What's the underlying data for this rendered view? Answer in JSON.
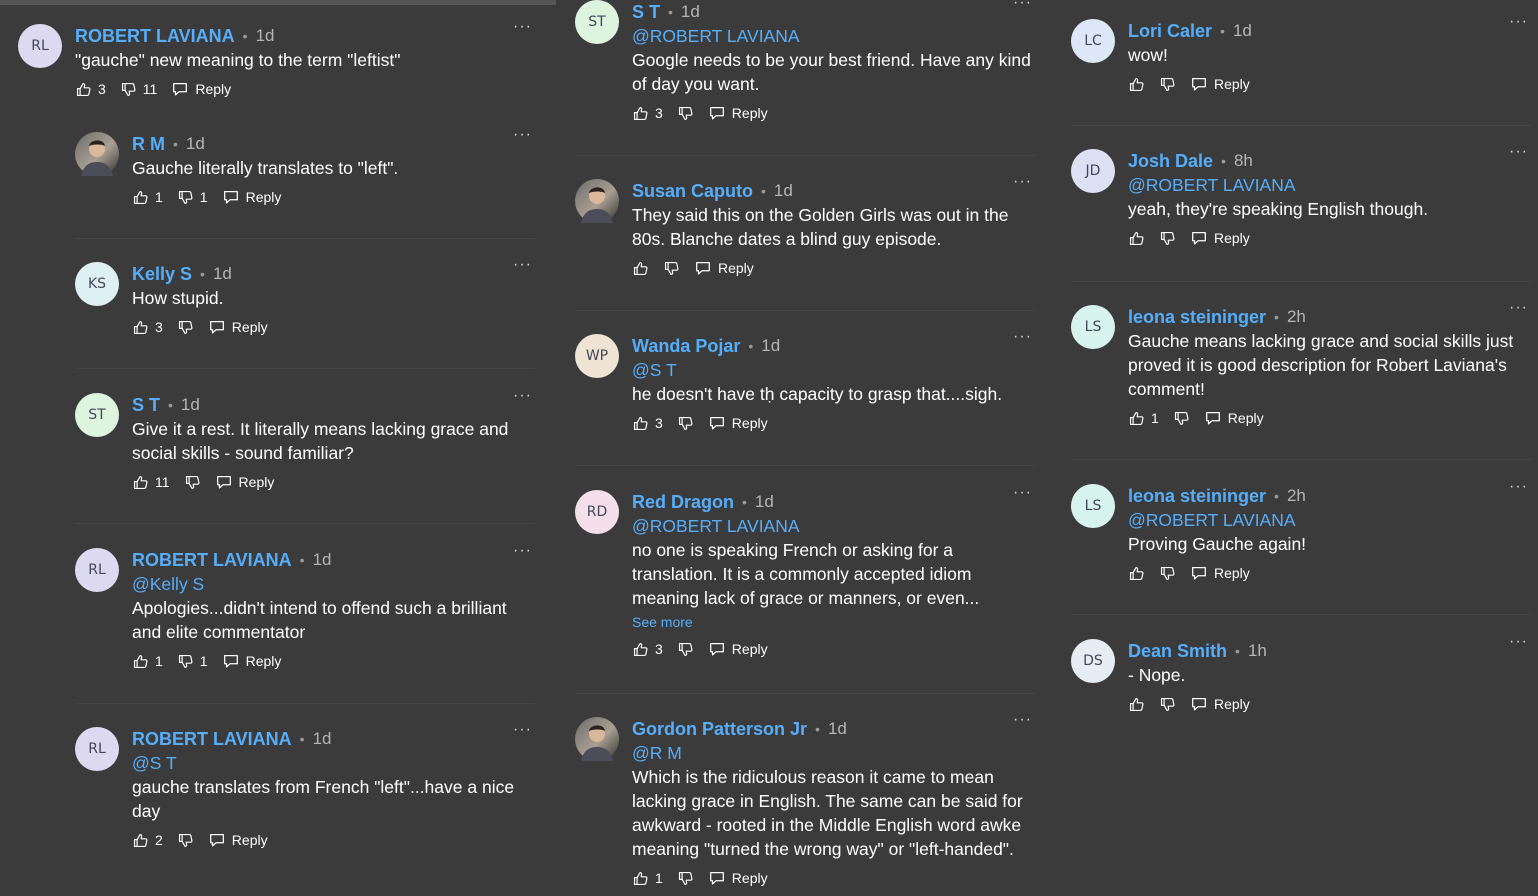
{
  "labels": {
    "reply": "Reply",
    "more": "···",
    "dot": "•",
    "see_more": "See more"
  },
  "colors": {
    "background": "#3b3b3b",
    "author": "#56aefb",
    "text": "#ffffff"
  },
  "columns": [
    [
      {
        "id": "c1",
        "author": "ROBERT LAVIANA",
        "time": "1d",
        "initials": "RL",
        "avatar_bg": "#ddd9f0",
        "text": "\"gauche\" new meaning to the term \"leftist\"",
        "likes": "3",
        "dislikes": "11"
      },
      {
        "id": "c2",
        "author": "R M",
        "time": "1d",
        "avatar_icon": "profile-photo",
        "text": "Gauche literally translates to \"left\".",
        "likes": "1",
        "dislikes": "1"
      },
      {
        "id": "c3",
        "author": "Kelly S",
        "time": "1d",
        "initials": "KS",
        "avatar_bg": "#dff0f5",
        "text": "How stupid.",
        "likes": "3",
        "dislikes": ""
      },
      {
        "id": "c4",
        "author": "S T",
        "time": "1d",
        "initials": "ST",
        "avatar_bg": "#ddf5df",
        "text": "Give it a rest. It literally means lacking grace and social skills - sound familiar?",
        "likes": "11",
        "dislikes": ""
      },
      {
        "id": "c5",
        "author": "ROBERT LAVIANA",
        "time": "1d",
        "initials": "RL",
        "avatar_bg": "#ddd9f0",
        "mention": "@Kelly S",
        "text": "Apologies...didn't intend to offend such a brilliant and elite commentator",
        "likes": "1",
        "dislikes": "1"
      },
      {
        "id": "c6",
        "author": "ROBERT LAVIANA",
        "time": "1d",
        "initials": "RL",
        "avatar_bg": "#ddd9f0",
        "mention": "@S T",
        "text": "gauche translates from French \"left\"...have a nice day",
        "likes": "2",
        "dislikes": ""
      }
    ],
    [
      {
        "id": "c7",
        "author": "S T",
        "time": "1d",
        "initials": "ST",
        "avatar_bg": "#ddf5df",
        "mention": "@ROBERT LAVIANA",
        "text": "Google needs to be your best friend. Have any kind of day you want.",
        "likes": "3",
        "dislikes": ""
      },
      {
        "id": "c8",
        "author": "Susan Caputo",
        "time": "1d",
        "avatar_icon": "profile-photo",
        "text": "They said this on the Golden Girls was out in the 80s. Blanche dates a blind guy episode.",
        "likes": "",
        "dislikes": ""
      },
      {
        "id": "c9",
        "author": "Wanda Pojar",
        "time": "1d",
        "initials": "WP",
        "avatar_bg": "#efe3d3",
        "mention": "@S T",
        "text": "he doesn't have tḥ capacity to grasp that....sigh.",
        "likes": "3",
        "dislikes": ""
      },
      {
        "id": "c10",
        "author": "Red Dragon",
        "time": "1d",
        "initials": "RD",
        "avatar_bg": "#f5dfea",
        "mention": "@ROBERT LAVIANA",
        "text": "no one is speaking French or asking for a translation.  It is a commonly accepted idiom meaning lack of grace or manners, or even...",
        "see_more": true,
        "likes": "3",
        "dislikes": ""
      },
      {
        "id": "c11",
        "author": "Gordon Patterson Jr",
        "time": "1d",
        "avatar_icon": "profile-photo",
        "mention": "@R M",
        "text": "Which is the ridiculous reason it came to mean lacking grace in English. The same can be said for awkward - rooted in the Middle English word awke meaning \"turned the wrong way\" or \"left-handed\".",
        "likes": "1",
        "dislikes": ""
      }
    ],
    [
      {
        "id": "c12",
        "author": "Lori Caler",
        "time": "1d",
        "initials": "LC",
        "avatar_bg": "#dde7f7",
        "text": "wow!",
        "likes": "",
        "dislikes": ""
      },
      {
        "id": "c13",
        "author": "Josh Dale",
        "time": "8h",
        "initials": "JD",
        "avatar_bg": "#dddff2",
        "mention": "@ROBERT LAVIANA",
        "text": "yeah, they're speaking English though.",
        "likes": "",
        "dislikes": ""
      },
      {
        "id": "c14",
        "author": "leona steininger",
        "time": "2h",
        "initials": "LS",
        "avatar_bg": "#d6f3ee",
        "text": "Gauche means lacking grace and social skills just proved it is good description for Robert Laviana's comment!",
        "likes": "1",
        "dislikes": ""
      },
      {
        "id": "c15",
        "author": "leona steininger",
        "time": "2h",
        "initials": "LS",
        "avatar_bg": "#d6f3ee",
        "mention": "@ROBERT LAVIANA",
        "text": "Proving Gauche again!",
        "likes": "",
        "dislikes": ""
      },
      {
        "id": "c16",
        "author": "Dean Smith",
        "time": "1h",
        "initials": "DS",
        "avatar_bg": "#e6edf5",
        "text": "- Nope.",
        "likes": "",
        "dislikes": ""
      }
    ]
  ]
}
